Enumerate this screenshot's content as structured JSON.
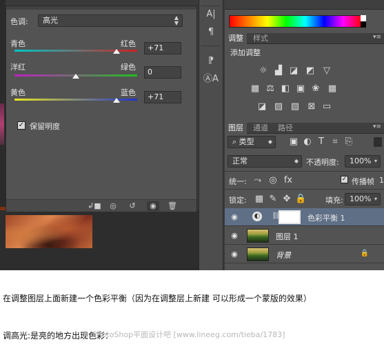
{
  "properties": {
    "tone_label": "色调:",
    "tone_value": "高光",
    "sliders": [
      {
        "left": "青色",
        "right": "红色",
        "value": "+71",
        "position": 0.87
      },
      {
        "left": "洋红",
        "right": "绿色",
        "value": "0",
        "position": 0.5
      },
      {
        "left": "黄色",
        "right": "蓝色",
        "value": "+71",
        "position": 0.87
      }
    ],
    "preserve_luminosity_label": "保留明度",
    "preserve_luminosity_checked": true
  },
  "right_panel": {
    "adjust_tabs": [
      "调整",
      "样式"
    ],
    "adjust_title": "添加调整",
    "layers_tabs": [
      "图层",
      "通道",
      "路径"
    ],
    "filter_type": "类型",
    "blend_mode": "正常",
    "opacity_label": "不透明度:",
    "opacity_value": "100%",
    "unify_label": "统一:",
    "propagate_label": "传播帧",
    "propagate_count": "1",
    "lock_label": "锁定:",
    "fill_label": "填充:",
    "fill_value": "100%",
    "layers": [
      {
        "name": "色彩平衡 1",
        "type": "adjustment",
        "selected": true
      },
      {
        "name": "图层 1",
        "type": "pixel",
        "selected": false
      },
      {
        "name": "背景",
        "type": "background",
        "selected": false
      }
    ]
  },
  "caption": {
    "line1": "在调整图层上面新建一个色彩平衡（因为在调整层上新建 可以形成一个蒙版的效果）",
    "line2": "调高光:是亮的地方出现色彩：",
    "watermark": "PhotoShop平面设计吧 [www.lineeg.com/tieba/1783]"
  },
  "colors": {
    "panel_bg": "#535353",
    "selected_layer": "#5f6f86",
    "cyan_red_track": [
      "#00c8c8",
      "#d02020"
    ],
    "magenta_green_track": [
      "#c020c0",
      "#20c020"
    ],
    "yellow_blue_track": [
      "#e8e820",
      "#2030d0"
    ]
  }
}
